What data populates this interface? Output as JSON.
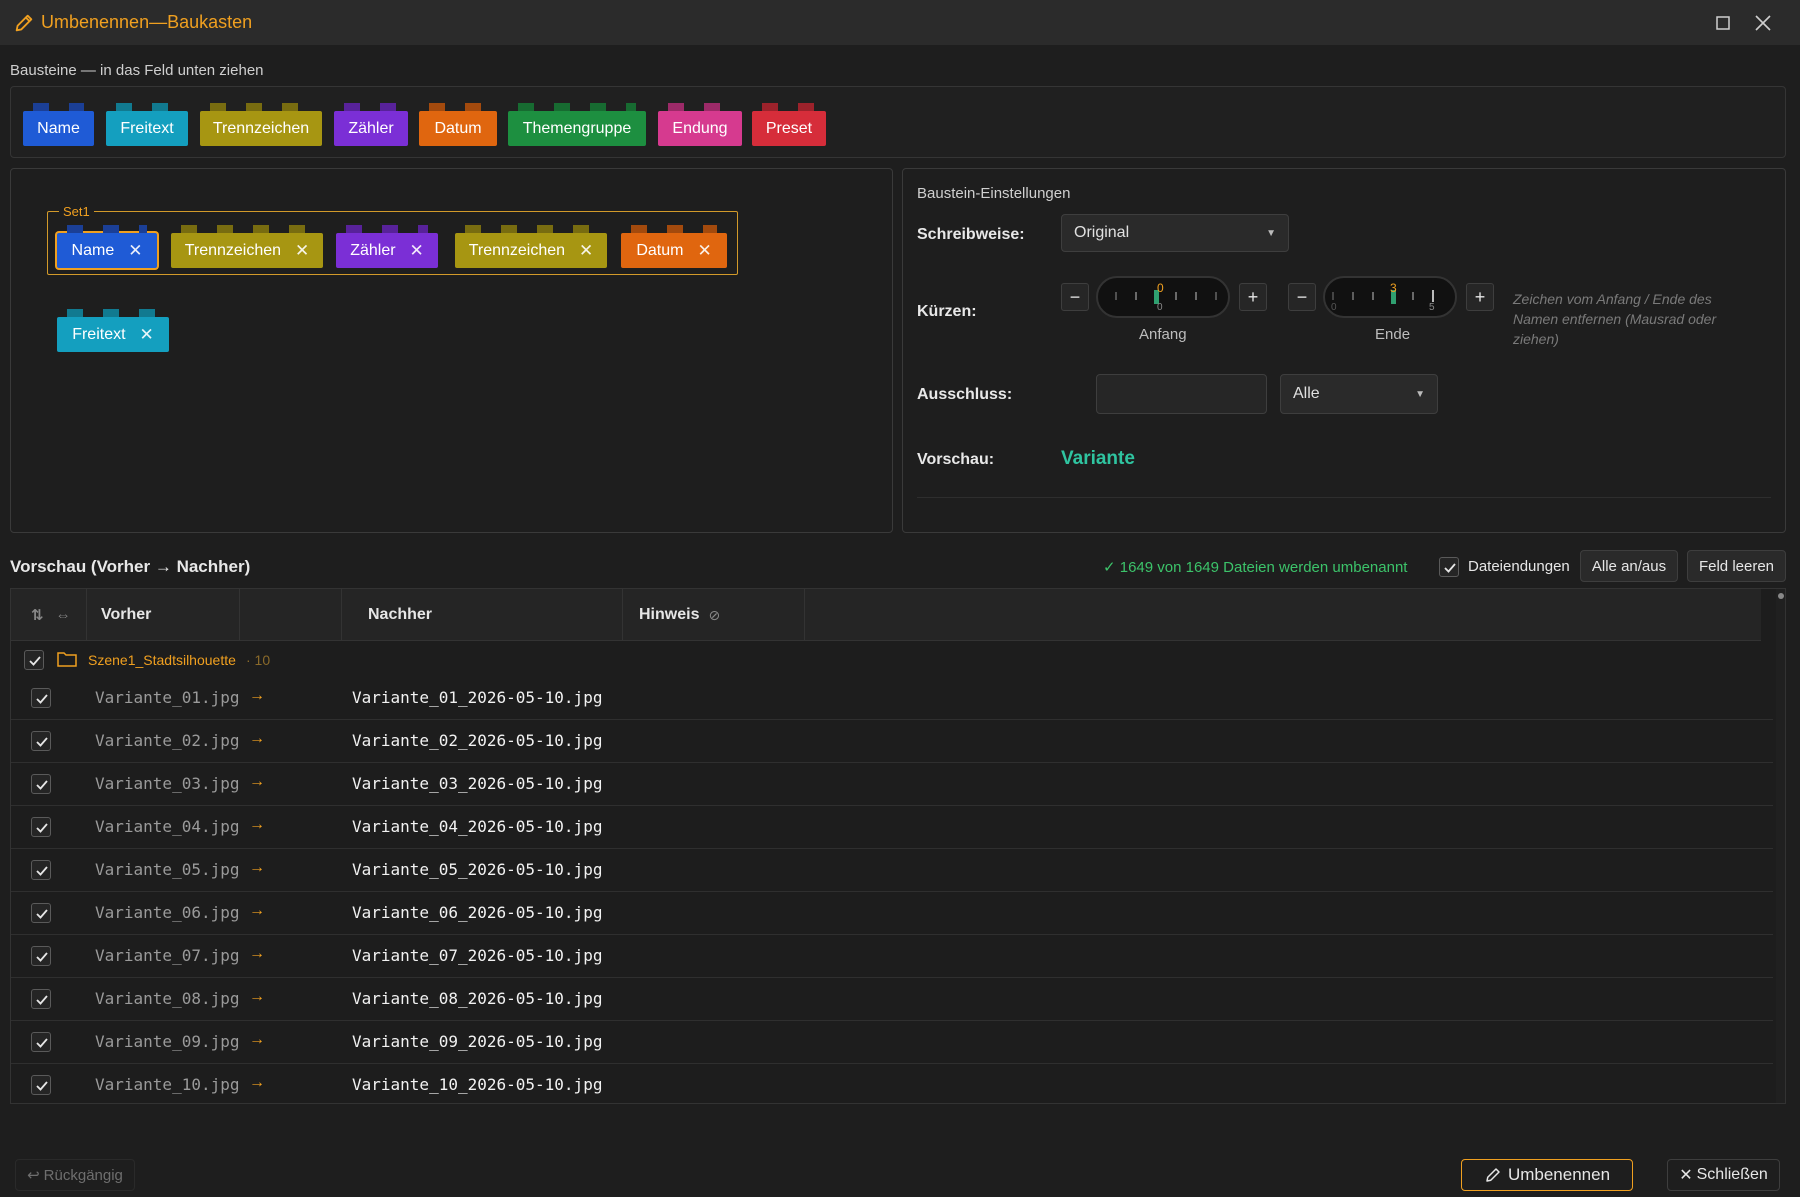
{
  "window": {
    "title": "Umbenennen—Baukasten"
  },
  "palette": {
    "label": "Bausteine — in das Feld unten ziehen",
    "bricks": [
      {
        "label": "Name",
        "color": "#1f5bd6",
        "stud": "#1b3f96"
      },
      {
        "label": "Freitext",
        "color": "#149fbf",
        "stud": "#117a90"
      },
      {
        "label": "Trennzeichen",
        "color": "#a79612",
        "stud": "#786c10"
      },
      {
        "label": "Zähler",
        "color": "#7b2fd6",
        "stud": "#58229a"
      },
      {
        "label": "Datum",
        "color": "#e0660f",
        "stud": "#a34a0d"
      },
      {
        "label": "Themengruppe",
        "color": "#1d8f40",
        "stud": "#176b31"
      },
      {
        "label": "Endung",
        "color": "#d63a8f",
        "stud": "#9c2a68"
      },
      {
        "label": "Preset",
        "color": "#d62d3a",
        "stud": "#9c222b"
      }
    ]
  },
  "stage": {
    "set_label": "Set1",
    "set_chips": [
      {
        "label": "Name",
        "color": "#1f5bd6",
        "stud": "#1b3f96",
        "selected": true
      },
      {
        "label": "Trennzeichen",
        "color": "#a79612",
        "stud": "#786c10"
      },
      {
        "label": "Zähler",
        "color": "#7b2fd6",
        "stud": "#58229a"
      },
      {
        "label": "Trennzeichen",
        "color": "#a79612",
        "stud": "#786c10"
      },
      {
        "label": "Datum",
        "color": "#e0660f",
        "stud": "#a34a0d"
      }
    ],
    "loose_chip": {
      "label": "Freitext",
      "color": "#149fbf",
      "stud": "#117a90"
    }
  },
  "settings": {
    "heading": "Baustein-Einstellungen",
    "schreibweise_label": "Schreibweise:",
    "schreibweise_value": "Original",
    "kuerzen_label": "Kürzen:",
    "anfang_label": "Anfang",
    "anfang_value": "0",
    "anfang_scale_min": "0",
    "ende_label": "Ende",
    "ende_value": "3",
    "ende_scale_min": "0",
    "ende_scale_max": "5",
    "kuerzen_hint": "Zeichen vom Anfang / Ende des Namen entfernen (Mausrad oder ziehen)",
    "ausschluss_label": "Ausschluss:",
    "ausschluss_value": "",
    "ausschluss_mode": "Alle",
    "vorschau_label": "Vorschau:",
    "vorschau_value": "Variante",
    "vorschau_color": "#2fc4a0"
  },
  "preview": {
    "heading": "Vorschau (Vorher → Nachher)",
    "status": "✓ 1649 von 1649 Dateien werden umbenannt",
    "status_color": "#3cc36a",
    "extensions_label": "Dateiendungen",
    "toggle_all_label": "Alle an/aus",
    "clear_label": "Feld leeren",
    "columns": {
      "before": "Vorher",
      "after": "Nachher",
      "note": "Hinweis"
    },
    "group": {
      "name": "Szene1_Stadtsilhouette",
      "count": "· 10"
    },
    "rows": [
      {
        "before": "Variante_01.jpg",
        "arrow": "→",
        "after": "Variante_01_2026-05-10.jpg"
      },
      {
        "before": "Variante_02.jpg",
        "arrow": "→",
        "after": "Variante_02_2026-05-10.jpg"
      },
      {
        "before": "Variante_03.jpg",
        "arrow": "→",
        "after": "Variante_03_2026-05-10.jpg"
      },
      {
        "before": "Variante_04.jpg",
        "arrow": "→",
        "after": "Variante_04_2026-05-10.jpg"
      },
      {
        "before": "Variante_05.jpg",
        "arrow": "→",
        "after": "Variante_05_2026-05-10.jpg"
      },
      {
        "before": "Variante_06.jpg",
        "arrow": "→",
        "after": "Variante_06_2026-05-10.jpg"
      },
      {
        "before": "Variante_07.jpg",
        "arrow": "→",
        "after": "Variante_07_2026-05-10.jpg"
      },
      {
        "before": "Variante_08.jpg",
        "arrow": "→",
        "after": "Variante_08_2026-05-10.jpg"
      },
      {
        "before": "Variante_09.jpg",
        "arrow": "→",
        "after": "Variante_09_2026-05-10.jpg"
      },
      {
        "before": "Variante_10.jpg",
        "arrow": "→",
        "after": "Variante_10_2026-05-10.jpg"
      }
    ]
  },
  "footer": {
    "undo_label": "Rückgängig",
    "rename_label": "Umbenennen",
    "close_label": "Schließen",
    "accent": "#f0a020"
  }
}
